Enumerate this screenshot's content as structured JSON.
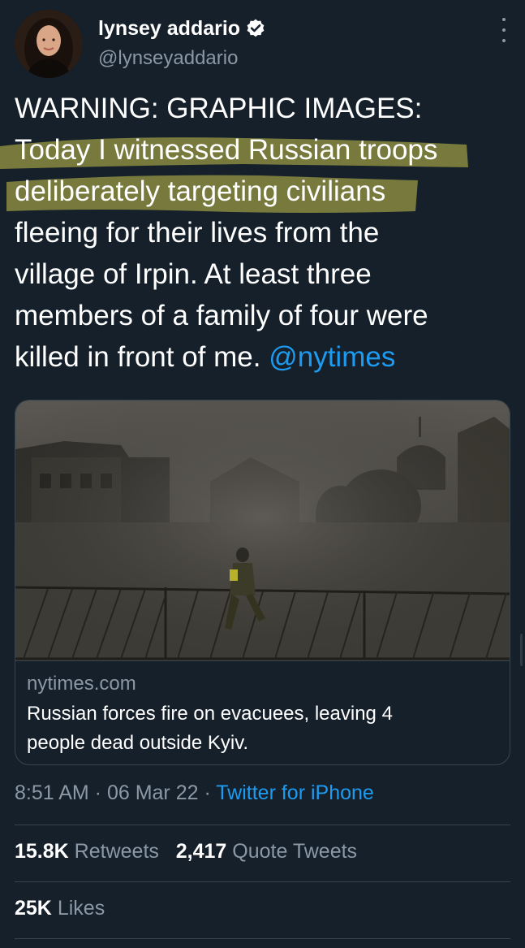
{
  "author": {
    "name": "lynsey addario",
    "handle": "@lynseyaddario",
    "verified": true,
    "avatar_icon": "profile-photo-avatar"
  },
  "tweet": {
    "lines": [
      "WARNING: GRAPHIC IMAGES:",
      "Today I witnessed Russian troops",
      "deliberately targeting civilians",
      "fleeing for their lives from the",
      "village of Irpin. At least three",
      "members of a family of four were",
      "killed in front of me. "
    ],
    "mention": "@nytimes",
    "highlight_color": "#c8c44a"
  },
  "card": {
    "domain": "nytimes.com",
    "title_line1": "Russian forces fire on evacuees, leaving 4",
    "title_line2": "people dead outside Kyiv."
  },
  "meta": {
    "time": "8:51 AM",
    "separator": " · ",
    "date": "06 Mar 22",
    "source": "Twitter for iPhone"
  },
  "stats": {
    "retweets_count": "15.8K",
    "retweets_label": "Retweets",
    "quotes_count": "2,417",
    "quotes_label": "Quote Tweets",
    "likes_count": "25K",
    "likes_label": "Likes"
  },
  "colors": {
    "background": "#15202b",
    "link": "#1d9bf0",
    "secondary_text": "#8b98a5",
    "border": "#38444d"
  }
}
